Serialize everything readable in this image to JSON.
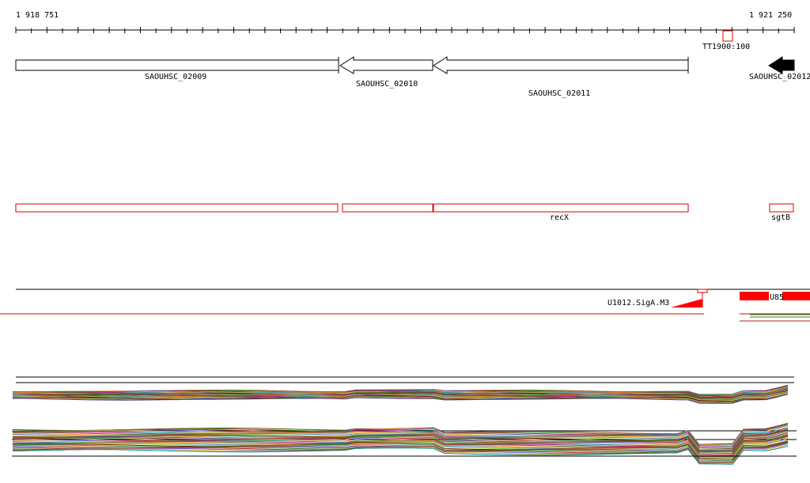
{
  "coordinates": {
    "start": "1 918 751",
    "end": "1 921 250"
  },
  "range": {
    "start": 1918751,
    "end": 1921250
  },
  "genes": [
    {
      "id": "SAOUHSC_02009",
      "label": "SAOUHSC_02009",
      "start": 1918751,
      "end": 1919786,
      "strand": "+"
    },
    {
      "id": "SAOUHSC_02010",
      "label": "SAOUHSC_02010",
      "start": 1919787,
      "end": 1920091,
      "strand": "-"
    },
    {
      "id": "SAOUHSC_02011",
      "label": "SAOUHSC_02011",
      "start": 1920092,
      "end": 1920911,
      "strand": "-"
    },
    {
      "id": "SAOUHSC_02012",
      "label": "SAOUHSC_02012",
      "start": 1921121,
      "end": 1921250,
      "strand": "-"
    }
  ],
  "terminator": {
    "label": "TT1900:100"
  },
  "annotations": [
    {
      "label": "",
      "start": 1918751,
      "end": 1919786
    },
    {
      "label": "",
      "start": 1919800,
      "end": 1920091
    },
    {
      "label": "recX",
      "start": 1920092,
      "end": 1920911
    },
    {
      "label": "sgtB",
      "start": 1921170,
      "end": 1921250
    }
  ],
  "promoter": {
    "label": "U1012.SigA.M3"
  },
  "feature_right": {
    "label": "U85"
  },
  "colors": {
    "track_line": "#000000",
    "annotation": "#dd0000",
    "gene_fill": "#ffffff",
    "gene_fill_solid": "#000000",
    "expression": [
      "#8b4513",
      "#228b22",
      "#b22222",
      "#6a5acd",
      "#daa520",
      "#008b8b",
      "#c71585",
      "#556b2f",
      "#ff8c00",
      "#4682b4",
      "#9acd32",
      "#800000",
      "#2e8b57",
      "#d2691e",
      "#483d8b"
    ]
  }
}
